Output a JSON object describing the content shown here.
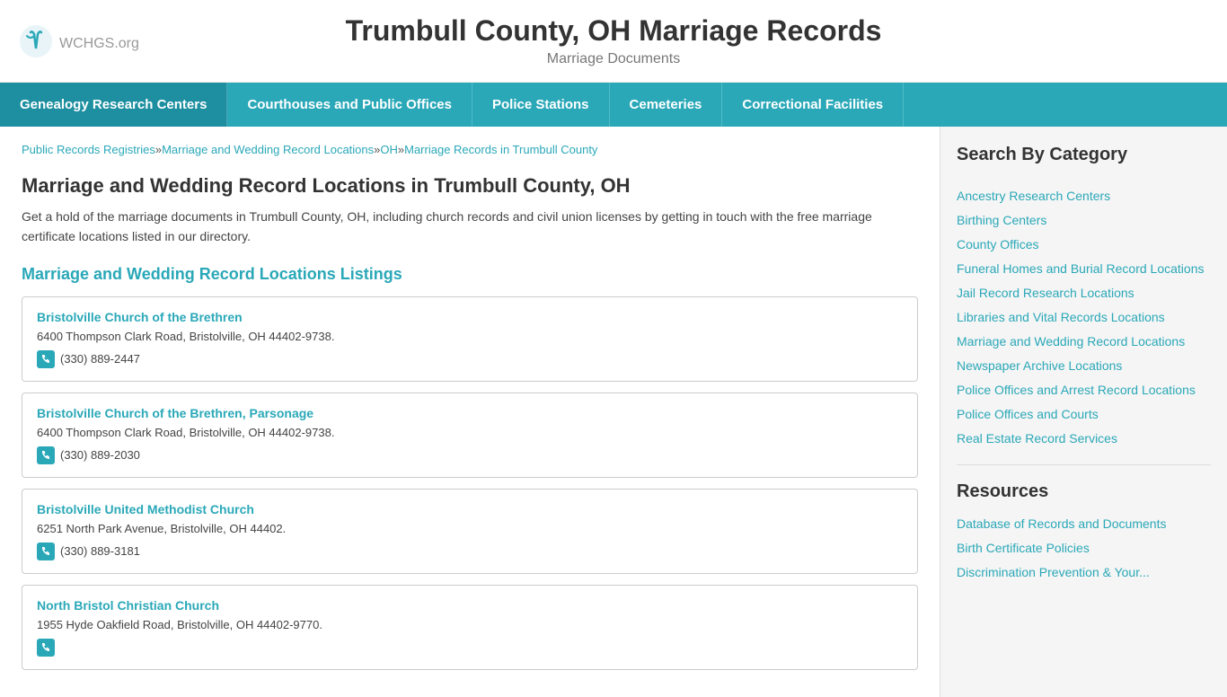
{
  "header": {
    "logo_text": "WCHGS",
    "logo_suffix": ".org",
    "title": "Trumbull County, OH Marriage Records",
    "subtitle": "Marriage Documents"
  },
  "nav": {
    "items": [
      {
        "label": "Genealogy Research Centers",
        "active": true
      },
      {
        "label": "Courthouses and Public Offices"
      },
      {
        "label": "Police Stations"
      },
      {
        "label": "Cemeteries"
      },
      {
        "label": "Correctional Facilities"
      }
    ]
  },
  "breadcrumb": {
    "items": [
      {
        "label": "Public Records Registries",
        "href": "#"
      },
      {
        "label": "Marriage and Wedding Record Locations",
        "href": "#"
      },
      {
        "label": "OH",
        "href": "#"
      },
      {
        "label": "Marriage Records in Trumbull County",
        "href": "#"
      }
    ]
  },
  "main": {
    "page_heading": "Marriage and Wedding Record Locations in Trumbull County, OH",
    "page_desc": "Get a hold of the marriage documents in Trumbull County, OH, including church records and civil union licenses by getting in touch with the free marriage certificate locations listed in our directory.",
    "listings_heading": "Marriage and Wedding Record Locations Listings",
    "locations": [
      {
        "name": "Bristolville Church of the Brethren",
        "address": "6400 Thompson Clark Road, Bristolville, OH 44402-9738.",
        "phone": "(330) 889-2447"
      },
      {
        "name": "Bristolville Church of the Brethren, Parsonage",
        "address": "6400 Thompson Clark Road, Bristolville, OH 44402-9738.",
        "phone": "(330) 889-2030"
      },
      {
        "name": "Bristolville United Methodist Church",
        "address": "6251 North Park Avenue, Bristolville, OH 44402.",
        "phone": "(330) 889-3181"
      },
      {
        "name": "North Bristol Christian Church",
        "address": "1955 Hyde Oakfield Road, Bristolville, OH 44402-9770.",
        "phone": ""
      }
    ]
  },
  "sidebar": {
    "search_by_category_title": "Search By Category",
    "category_links": [
      "Ancestry Research Centers",
      "Birthing Centers",
      "County Offices",
      "Funeral Homes and Burial Record Locations",
      "Jail Record Research Locations",
      "Libraries and Vital Records Locations",
      "Marriage and Wedding Record Locations",
      "Newspaper Archive Locations",
      "Police Offices and Arrest Record Locations",
      "Police Offices and Courts",
      "Real Estate Record Services"
    ],
    "resources_title": "Resources",
    "resource_links": [
      "Database of Records and Documents",
      "Birth Certificate Policies",
      "Discrimination Prevention & Your..."
    ]
  }
}
